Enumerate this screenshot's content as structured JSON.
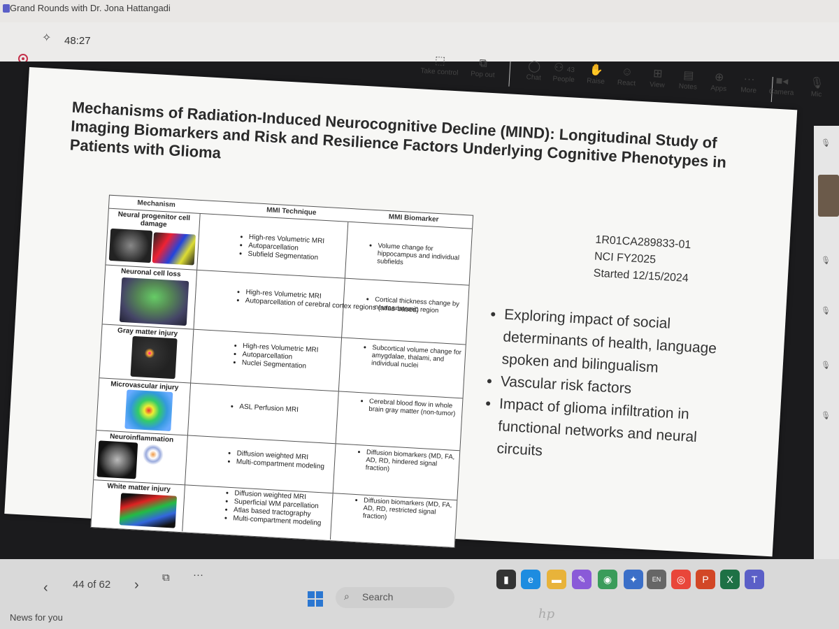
{
  "meeting": {
    "title": "Grand Rounds with Dr. Jona Hattangadi",
    "timer": "48:27"
  },
  "toolbar": {
    "items": [
      {
        "label": "Take control",
        "icon": "take-control-icon"
      },
      {
        "label": "Pop out",
        "icon": "pop-out-icon"
      },
      {
        "label": "Chat",
        "icon": "chat-icon"
      },
      {
        "label": "People",
        "icon": "people-icon",
        "badge": "43"
      },
      {
        "label": "Raise",
        "icon": "raise-hand-icon"
      },
      {
        "label": "React",
        "icon": "react-icon"
      },
      {
        "label": "View",
        "icon": "view-icon"
      },
      {
        "label": "Notes",
        "icon": "notes-icon"
      },
      {
        "label": "Apps",
        "icon": "apps-icon"
      },
      {
        "label": "More",
        "icon": "more-icon"
      },
      {
        "label": "Camera",
        "icon": "camera-icon"
      },
      {
        "label": "Mic",
        "icon": "mic-icon"
      }
    ]
  },
  "slide": {
    "title": "Mechanisms of Radiation-Induced Neurocognitive Decline (MIND): Longitudinal Study of Imaging Biomarkers and Risk and Resilience Factors Underlying Cognitive Phenotypes in Patients with Glioma",
    "grant": {
      "id": "1R01CA289833-01",
      "fy": "NCI FY2025",
      "started": "Started 12/15/2024"
    },
    "bullets": [
      "Exploring impact of social determinants of health, language spoken and bilingualism",
      "Vascular risk factors",
      "Impact of glioma infiltration in functional networks and neural circuits"
    ],
    "table": {
      "headers": [
        "Mechanism",
        "MMI Technique",
        "MMI Biomarker"
      ],
      "rows": [
        {
          "mechanism": "Neural progenitor cell damage",
          "technique": [
            "High-res Volumetric MRI",
            "Autoparcellation",
            "Subfield Segmentation"
          ],
          "biomarker": [
            "Volume change for hippocampus and individual subfields"
          ]
        },
        {
          "mechanism": "Neuronal cell loss",
          "technique": [
            "High-res Volumetric MRI",
            "Autoparcellation of cerebral cortex regions (atlas-based)"
          ],
          "biomarker": [
            "Cortical thickness change by neuroanatomic region"
          ]
        },
        {
          "mechanism": "Gray matter injury",
          "technique": [
            "High-res Volumetric MRI",
            "Autoparcellation",
            "Nuclei Segmentation"
          ],
          "biomarker": [
            "Subcortical volume change for amygdalae, thalami, and individual nuclei"
          ]
        },
        {
          "mechanism": "Microvascular injury",
          "technique": [
            "ASL Perfusion MRI"
          ],
          "biomarker": [
            "Cerebral blood flow in whole brain gray matter (non-tumor)"
          ]
        },
        {
          "mechanism": "Neuroinflammation",
          "technique": [
            "Diffusion weighted MRI",
            "Multi-compartment modeling"
          ],
          "biomarker": [
            "Diffusion biomarkers (MD, FA, AD, RD, hindered signal fraction)"
          ]
        },
        {
          "mechanism": "White matter injury",
          "technique": [
            "Diffusion weighted MRI",
            "Superficial WM parcellation",
            "Atlas based tractography",
            "Multi-compartment modeling"
          ],
          "biomarker": [
            "Diffusion biomarkers (MD, FA, AD, RD, restricted signal fraction)"
          ]
        }
      ]
    }
  },
  "presenter": {
    "page": "44 of 62"
  },
  "taskbar": {
    "search": "Search",
    "news": "News for you",
    "brand": "hp"
  }
}
